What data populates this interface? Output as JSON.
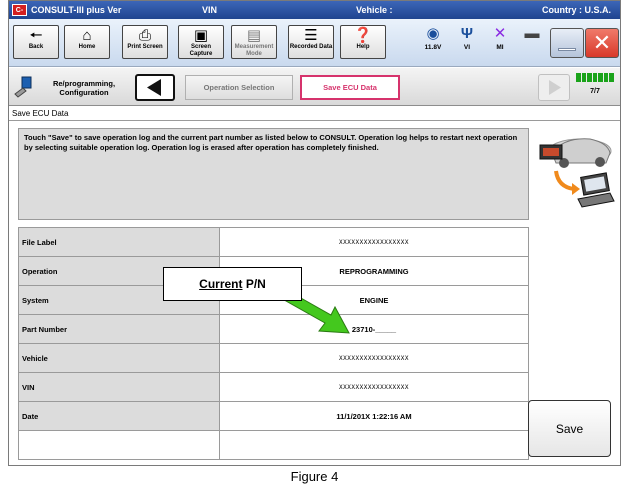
{
  "titlebar": {
    "logo": "C-III",
    "app_name": "CONSULT-III plus Ver",
    "vin_label": "VIN",
    "vehicle_label": "Vehicle :",
    "country": "Country : U.S.A."
  },
  "toolbar": {
    "back": "Back",
    "home": "Home",
    "print_screen": "Print Screen",
    "screen_capture": "Screen Capture",
    "measurement_mode": "Measurement Mode",
    "recorded_data": "Recorded Data",
    "help": "Help",
    "battery_voltage": "11.8V",
    "vi_label": "VI",
    "mi_label": "MI"
  },
  "navbar": {
    "reprogramming": "Re/programming, Configuration",
    "operation_selection": "Operation Selection",
    "save_ecu_data": "Save ECU Data",
    "page_indicator": "7/7",
    "progress": {
      "current": 7,
      "total": 7
    }
  },
  "page": {
    "heading": "Save ECU Data",
    "message": "Touch \"Save\" to save operation log and the current part number as listed below to CONSULT. Operation log helps to restart next operation by selecting suitable operation log. Operation log is erased after operation has completely finished."
  },
  "info_table": [
    {
      "label": "File Label",
      "value": "XXXXXXXXXXXXXXXXX"
    },
    {
      "label": "Operation",
      "value": "REPROGRAMMING"
    },
    {
      "label": "System",
      "value": "ENGINE"
    },
    {
      "label": "Part Number",
      "value": "23710-_____"
    },
    {
      "label": "Vehicle",
      "value": "XXXXXXXXXXXXXXXXX"
    },
    {
      "label": "VIN",
      "value": "XXXXXXXXXXXXXXXXX"
    },
    {
      "label": "Date",
      "value": "11/1/201X 1:22:16 AM"
    }
  ],
  "save_button": "Save",
  "callout": {
    "underlined": "Current",
    "rest": " P/N"
  },
  "caption": "Figure 4",
  "colors": {
    "title_bar": "#1f448f",
    "active_tab_border": "#d6336c",
    "callout_arrow": "#44c81e",
    "close_button": "#e04a3c",
    "progress_green": "#1aa31a"
  }
}
